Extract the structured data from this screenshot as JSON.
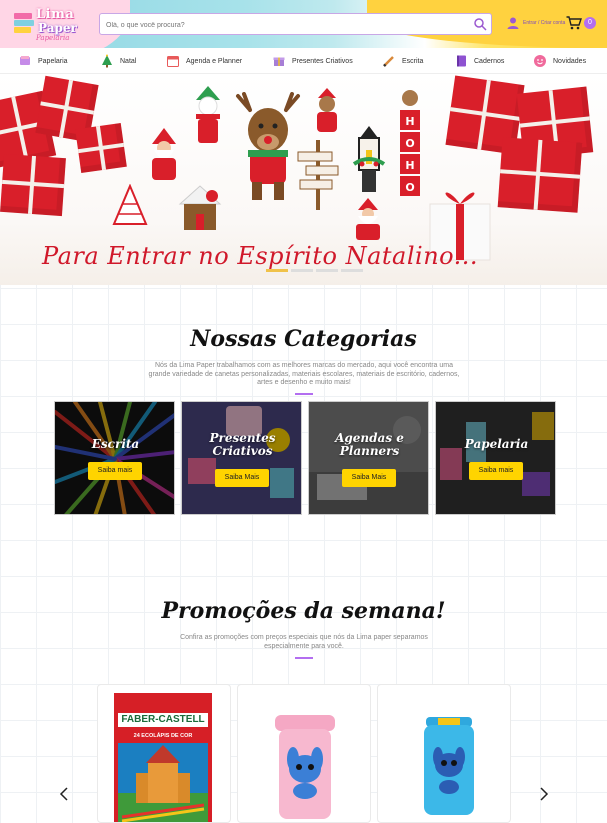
{
  "header": {
    "logo": {
      "line1": "Lima",
      "line2": "Paper",
      "line3": "Papelaria"
    },
    "search": {
      "placeholder": "Olá, o que você procura?"
    },
    "login_label": "Entrar / Criar conta",
    "cart_count": "0"
  },
  "nav": {
    "items": [
      {
        "label": "Papelaria",
        "icon": "notebook-icon"
      },
      {
        "label": "Natal",
        "icon": "christmas-tree-icon"
      },
      {
        "label": "Agenda e Planner",
        "icon": "calendar-icon"
      },
      {
        "label": "Presentes Criativos",
        "icon": "gift-box-icon"
      },
      {
        "label": "Escrita",
        "icon": "pencil-icon"
      },
      {
        "label": "Cadernos",
        "icon": "notebook-purple-icon"
      },
      {
        "label": "Novidades",
        "icon": "smiley-icon"
      }
    ]
  },
  "banner": {
    "caption": "Para Entrar no Espírito Natalino...",
    "sign_text": "HOHO"
  },
  "categories": {
    "title": "Nossas Categorias",
    "description": "Nós da Lima Paper trabalhamos com as melhores marcas do mercado, aqui você encontra uma grande variedade de canetas personalizadas, materiais escolares, materiais de escritório, cadernos, artes e desenho e muito mais!",
    "cards": [
      {
        "title": "Escrita",
        "button": "Saiba mais"
      },
      {
        "title": "Presentes Criativos",
        "button": "Saiba Mais"
      },
      {
        "title": "Agendas e Planners",
        "button": "Saiba Mais"
      },
      {
        "title": "Papelaria",
        "button": "Saiba mais"
      }
    ]
  },
  "promotions": {
    "title": "Promoções da semana!",
    "description": "Confira as promoções com preços especiais que nós da Lima paper separamos especialmente para você.",
    "products": [
      {
        "brand": "FABER-CASTELL",
        "subtitle": "24 ECOLÁPIS DE COR",
        "image": "colored-pencils-box"
      },
      {
        "image": "pink-stitch-sharpener"
      },
      {
        "image": "blue-stitch-sharpener"
      }
    ]
  },
  "colors": {
    "accent_purple": "#b36ef0",
    "button_yellow": "#ffd400",
    "banner_red": "#d0182a"
  }
}
